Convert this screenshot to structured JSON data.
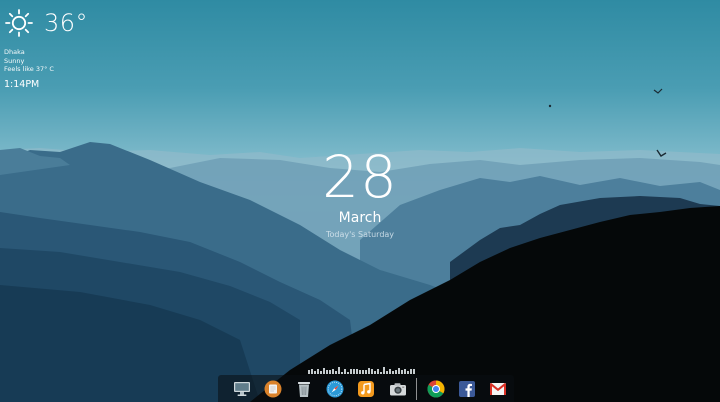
{
  "weather": {
    "temperature": "36°",
    "city": "Dhaka",
    "condition": "Sunny",
    "feels_like": "Feels like 37° C",
    "time": "1:14PM",
    "icon": "sun-icon"
  },
  "date": {
    "day": "28",
    "month": "March",
    "weekday": "Today's Saturday"
  },
  "dock": {
    "items": [
      {
        "name": "desktop-monitor-icon"
      },
      {
        "name": "notes-app-icon"
      },
      {
        "name": "trash-icon"
      },
      {
        "name": "safari-browser-icon"
      },
      {
        "name": "music-app-icon"
      },
      {
        "name": "camera-app-icon"
      },
      {
        "name": "chrome-browser-icon"
      },
      {
        "name": "facebook-icon"
      },
      {
        "name": "gmail-icon"
      }
    ]
  },
  "colors": {
    "sky_top": "#2f8ba3",
    "haze": "#a9cfd9",
    "mountain_dark": "#1e3f58",
    "forest": "#05080a"
  }
}
